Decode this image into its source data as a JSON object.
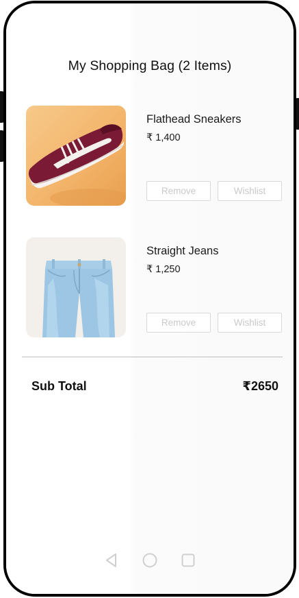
{
  "header": {
    "title": "My Shopping Bag (2 Items)"
  },
  "cart": {
    "items": [
      {
        "name": "Flathead Sneakers",
        "price": "₹ 1,400",
        "remove_label": "Remove",
        "wishlist_label": "Wishlist"
      },
      {
        "name": "Straight Jeans",
        "price": "₹ 1,250",
        "remove_label": "Remove",
        "wishlist_label": "Wishlist"
      }
    ]
  },
  "summary": {
    "subtotal_label": "Sub Total",
    "subtotal_value": "₹2650"
  },
  "navigation": {
    "icons": [
      "back-triangle-icon",
      "home-circle-icon",
      "recent-apps-square-icon"
    ]
  },
  "colors": {
    "button_border": "#d8d8d8",
    "button_text": "#c9c9c9",
    "divider": "#bdbdbd",
    "sneaker_bg": "#f3b56b",
    "sneaker_body": "#7a1a35",
    "jeans_bg": "#f3efea",
    "jeans_denim": "#9cc6e3"
  }
}
